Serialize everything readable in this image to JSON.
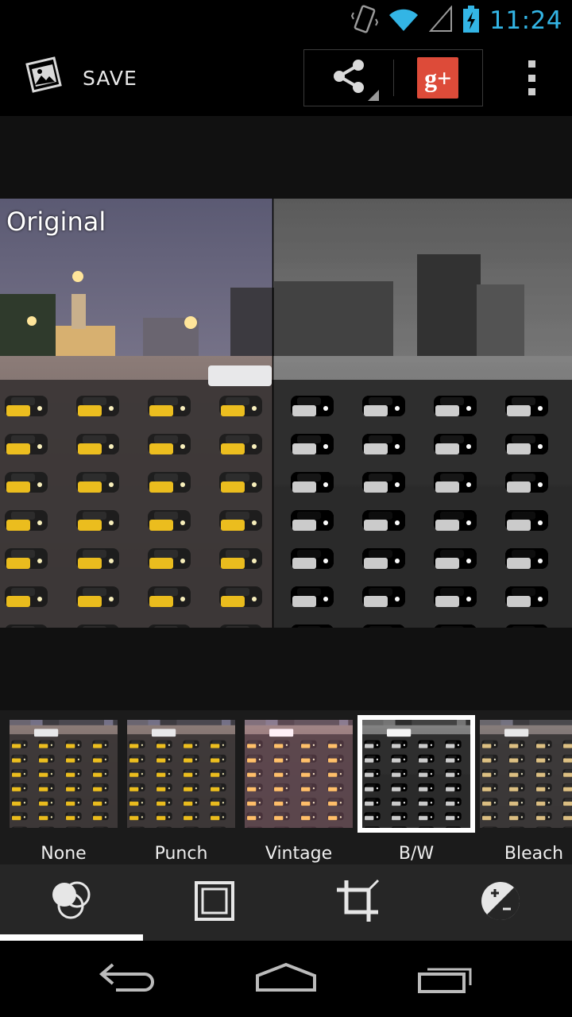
{
  "status_bar": {
    "time": "11:24",
    "icons": [
      "vibrate-icon",
      "wifi-icon",
      "cell-signal-icon",
      "battery-charging-icon"
    ],
    "accent_color": "#33b5e5"
  },
  "action_bar": {
    "save_label": "SAVE",
    "icons": [
      "photo-edit-icon",
      "share-icon",
      "google-plus-icon",
      "overflow-menu-icon"
    ],
    "gplus_glyph": "g+",
    "gplus_color": "#dd4b39"
  },
  "editor": {
    "compare_label": "Original",
    "left_half": "original color photo",
    "right_half": "B/W filter applied"
  },
  "filters": {
    "items": [
      {
        "label": "None"
      },
      {
        "label": "Punch"
      },
      {
        "label": "Vintage"
      },
      {
        "label": "B/W"
      },
      {
        "label": "Bleach"
      }
    ],
    "selected_label": "B/W"
  },
  "toolbar": {
    "tools": [
      "filters-icon",
      "frame-icon",
      "crop-icon",
      "exposure-icon"
    ],
    "active_tool": "filters-icon"
  },
  "nav_bar": {
    "buttons": [
      "back-icon",
      "home-icon",
      "recent-apps-icon"
    ]
  }
}
